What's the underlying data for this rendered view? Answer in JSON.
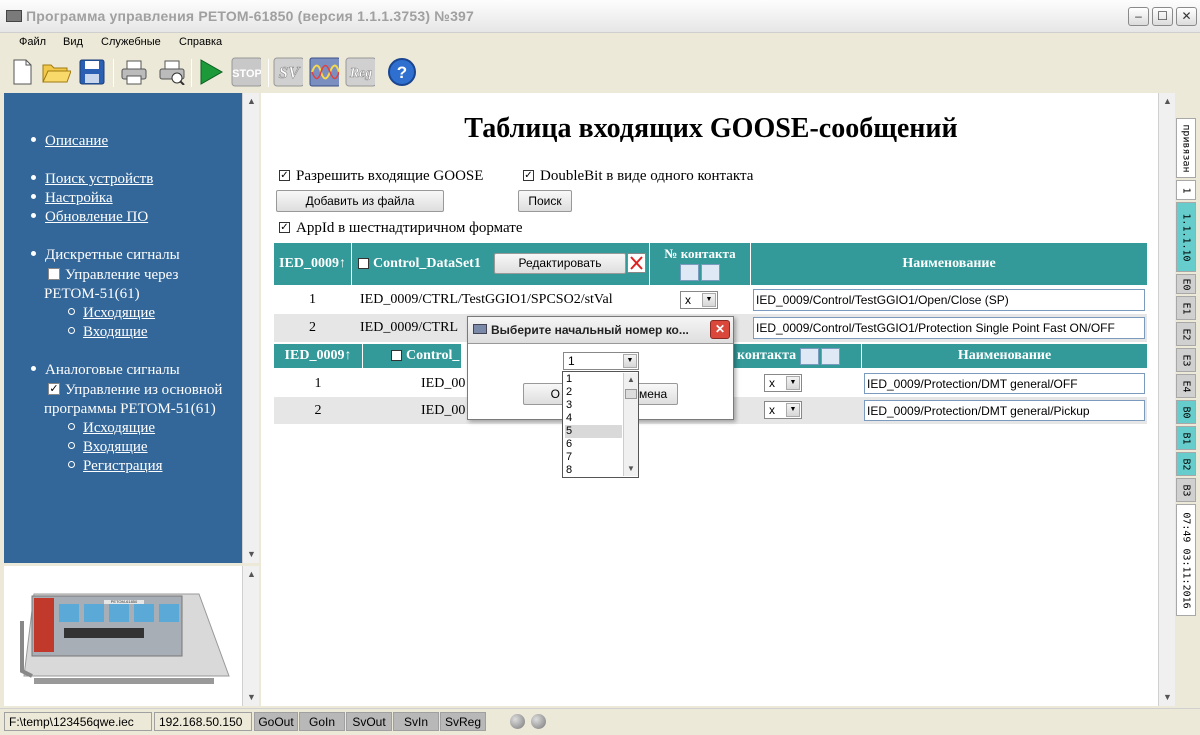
{
  "window": {
    "title": "Программа управления РЕТОМ-61850 (версия 1.1.1.3753) №397",
    "minimize": "–",
    "maximize": "☐",
    "close": "✕"
  },
  "menu": [
    "Файл",
    "Вид",
    "Служебные",
    "Справка"
  ],
  "toolbar": {
    "icons": [
      "new-file-icon",
      "open-folder-icon",
      "save-disk-icon",
      "print-icon",
      "print-preview-icon",
      "play-icon",
      "stop-icon",
      "sv-icon",
      "oscillogram-icon",
      "reg-icon",
      "help-icon"
    ],
    "stop_label": "STOP",
    "sv_label": "SV",
    "reg_label": "Reg",
    "help_label": "?"
  },
  "nav": {
    "description": "Описание",
    "search_devices": "Поиск устройств",
    "settings": "Настройка",
    "update": "Обновление ПО",
    "discrete_title": "Дискретные сигналы",
    "discrete_control_1": "Управление через",
    "discrete_control_2": "РЕТОМ-51(61)",
    "discrete_outgoing": "Исходящие",
    "discrete_incoming": "Входящие",
    "analog_title": "Аналоговые сигналы",
    "analog_control_1": "Управление из основной",
    "analog_control_2": "программы РЕТОМ-51(61)",
    "analog_outgoing": "Исходящие",
    "analog_incoming": "Входящие",
    "analog_registration": "Регистрация",
    "discrete_checked": false,
    "analog_checked": true
  },
  "device_panel": {
    "device_label": "РЕТОМ-61850"
  },
  "main": {
    "heading": "Таблица входящих GOOSE-сообщений",
    "allow_incoming": "Разрешить входящие GOOSE",
    "doublebit": "DoubleBit в виде одного контакта",
    "add_from_file": "Добавить из файла",
    "search": "Поиск",
    "appid_hex": "AppId в шестнадтиричном формате",
    "check_mark": "✓"
  },
  "table1": {
    "col_ied": "IED_0009↑",
    "col_dataset": "Control_DataSet1",
    "edit_button": "Редактировать",
    "col_contact": "№ контакта",
    "col_name": "Наименование",
    "rows": [
      {
        "num": "1",
        "path": "IED_0009/CTRL/TestGGIO1/SPCSO2/stVal",
        "contact": "x",
        "name": "IED_0009/Control/TestGGIO1/Open/Close (SP)"
      },
      {
        "num": "2",
        "path": "IED_0009/CTRL",
        "contact": "x",
        "name": "IED_0009/Control/TestGGIO1/Protection Single Point Fast ON/OFF"
      }
    ]
  },
  "table2": {
    "col_ied": "IED_0009↑",
    "col_dataset": "Control_",
    "col_contact": "контакта",
    "col_name": "Наименование",
    "rows": [
      {
        "num": "1",
        "path": "IED_00",
        "contact": "x",
        "name": "IED_0009/Protection/DMT general/OFF"
      },
      {
        "num": "2",
        "path": "IED_00",
        "contact": "x",
        "name": "IED_0009/Protection/DMT general/Pickup"
      }
    ]
  },
  "dialog": {
    "title": "Выберите начальный номер ко...",
    "selected": "1",
    "ok_fragment": "О",
    "cancel_fragment": "мена",
    "options": [
      "1",
      "2",
      "3",
      "4",
      "5",
      "6",
      "7",
      "8"
    ],
    "highlighted": "5"
  },
  "right_strip": {
    "cells": [
      {
        "text": "привязан",
        "color": "#ffffff"
      },
      {
        "text": "1",
        "color": "#ffffff"
      },
      {
        "text": "1.1.1.10",
        "color": "#66cccc"
      },
      {
        "text": "E0",
        "color": "#d0d0d0"
      },
      {
        "text": "E1",
        "color": "#d0d0d0"
      },
      {
        "text": "E2",
        "color": "#d0d0d0"
      },
      {
        "text": "E3",
        "color": "#d0d0d0"
      },
      {
        "text": "E4",
        "color": "#d0d0d0"
      },
      {
        "text": "B0",
        "color": "#66cccc"
      },
      {
        "text": "B1",
        "color": "#66cccc"
      },
      {
        "text": "B2",
        "color": "#66cccc"
      },
      {
        "text": "B3",
        "color": "#d0d0d0"
      },
      {
        "text": "07:49 03:11:2016",
        "color": "#ffffff"
      }
    ]
  },
  "status": {
    "path": "F:\\temp\\123456qwe.iec",
    "ip": "192.168.50.150",
    "goout": "GoOut",
    "goin": "GoIn",
    "svout": "SvOut",
    "svin": "SvIn",
    "svreg": "SvReg"
  },
  "colors": {
    "nav_bg": "#336699",
    "table_header": "#339999",
    "row_alt": "#e6e6e6"
  }
}
